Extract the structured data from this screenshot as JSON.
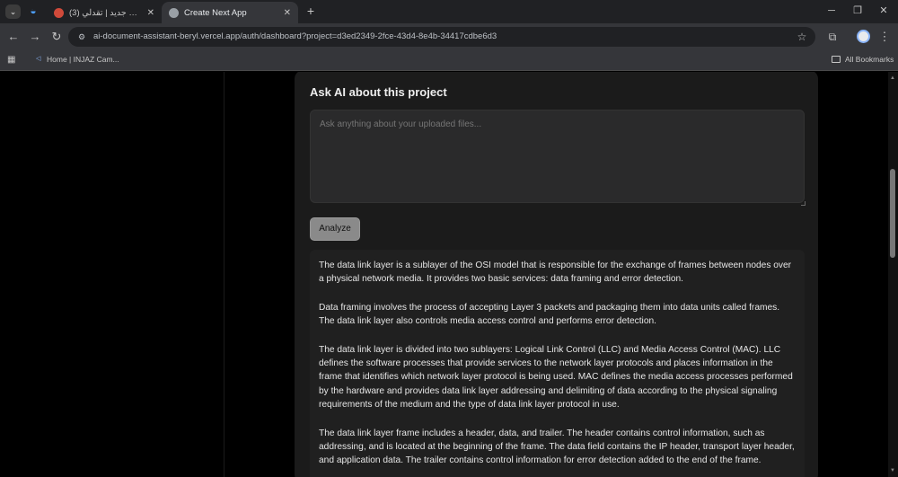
{
  "browser": {
    "tabs": [
      {
        "title": "إضافة خدمة جديد | تقدلي (3)",
        "active": false
      },
      {
        "title": "Create Next App",
        "active": true
      }
    ],
    "url": "ai-document-assistant-beryl.vercel.app/auth/dashboard?project=d3ed2349-2fce-43d4-8e4b-34417cdbe6d3",
    "bookmarks": [
      {
        "label": "Home | INJAZ Cam..."
      }
    ],
    "all_bookmarks_label": "All Bookmarks"
  },
  "assistant": {
    "heading": "Ask AI about this project",
    "input_placeholder": "Ask anything about your uploaded files...",
    "analyze_label": "Analyze",
    "answer_paragraphs": [
      "The data link layer is a sublayer of the OSI model that is responsible for the exchange of frames between nodes over a physical network media. It provides two basic services: data framing and error detection.",
      "Data framing involves the process of accepting Layer 3 packets and packaging them into data units called frames. The data link layer also controls media access control and performs error detection.",
      "The data link layer is divided into two sublayers: Logical Link Control (LLC) and Media Access Control (MAC). LLC defines the software processes that provide services to the network layer protocols and places information in the frame that identifies which network layer protocol is being used. MAC defines the media access processes performed by the hardware and provides data link layer addressing and delimiting of data according to the physical signaling requirements of the medium and the type of data link layer protocol in use.",
      "The data link layer frame includes a header, data, and trailer. The header contains control information, such as addressing, and is located at the beginning of the frame. The data field contains the IP header, transport layer header, and application data. The trailer contains control information for error detection added to the end of the frame."
    ]
  },
  "colors": {
    "page_background": "#000000",
    "panel_background": "#1b1b1b",
    "browser_chrome": "#35363a"
  }
}
